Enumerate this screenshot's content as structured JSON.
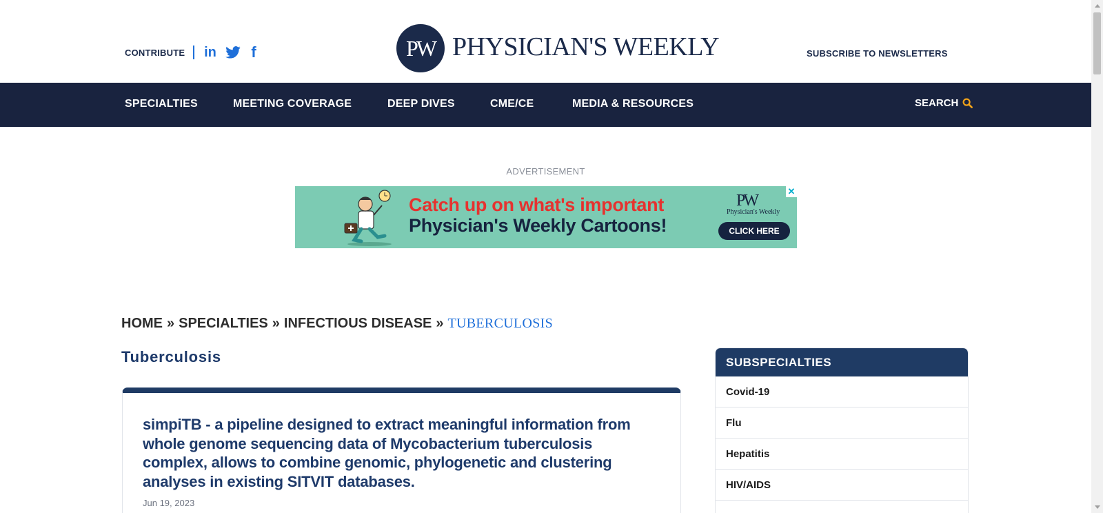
{
  "header": {
    "contribute": "CONTRIBUTE",
    "social": {
      "linkedin_glyph": "in",
      "twitter_icon": "twitter-icon",
      "facebook_glyph": "f"
    },
    "logo_mark": "PW",
    "logo_text": "PHYSICIAN'S WEEKLY",
    "subscribe": "SUBSCRIBE TO NEWSLETTERS"
  },
  "nav": {
    "items": [
      "SPECIALTIES",
      "MEETING COVERAGE",
      "DEEP DIVES",
      "CME/CE",
      "MEDIA & RESOURCES"
    ],
    "search_label": "SEARCH"
  },
  "colors": {
    "nav_bg": "#19233f",
    "accent_blue": "#1e6fd9",
    "title_blue": "#1e3a6a",
    "search_icon": "#f0a21a",
    "ad_bg": "#7ccbb3",
    "ad_red": "#e6322f"
  },
  "ad": {
    "label": "ADVERTISEMENT",
    "close": "✕",
    "line1": "Catch up on what's important",
    "line2": "Physician's Weekly Cartoons!",
    "logo_mark": "PW",
    "logo_text": "Physician's Weekly",
    "cta": "CLICK HERE"
  },
  "breadcrumb": {
    "items": [
      "HOME",
      "SPECIALTIES",
      "INFECTIOUS DISEASE"
    ],
    "separator": "»",
    "current": "TUBERCULOSIS"
  },
  "page_title": "Tuberculosis",
  "article": {
    "title": "simpiTB - a pipeline designed to extract meaningful information from whole genome sequencing data of Mycobacterium tuberculosis complex, allows to combine genomic, phylogenetic and clustering analyses in existing SITVIT databases.",
    "date": "Jun 19, 2023"
  },
  "sidebar": {
    "header": "SUBSPECIALTIES",
    "items": [
      "Covid-19",
      "Flu",
      "Hepatitis",
      "HIV/AIDS"
    ]
  }
}
